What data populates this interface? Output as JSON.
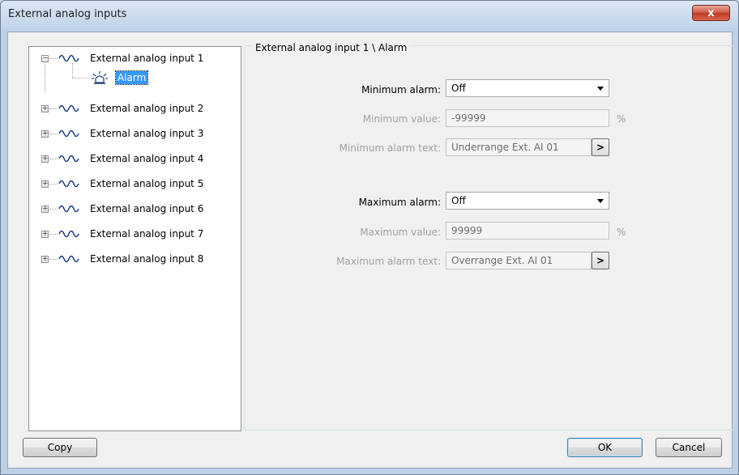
{
  "window": {
    "title": "External analog inputs",
    "close_label": "x"
  },
  "tree": {
    "inputs": [
      "External analog input 1",
      "External analog input 2",
      "External analog input 3",
      "External analog input 4",
      "External analog input 5",
      "External analog input 6",
      "External analog input 7",
      "External analog input 8"
    ],
    "selected_child": "Alarm"
  },
  "panel": {
    "title": "External analog input 1 \\ Alarm",
    "min_alarm_label": "Minimum alarm:",
    "min_alarm_value": "Off",
    "min_value_label": "Minimum value:",
    "min_value": "-99999",
    "min_unit": "%",
    "min_text_label": "Minimum alarm text:",
    "min_text": "Underrange Ext. AI 01",
    "max_alarm_label": "Maximum alarm:",
    "max_alarm_value": "Off",
    "max_value_label": "Maximum value:",
    "max_value": "99999",
    "max_unit": "%",
    "max_text_label": "Maximum alarm text:",
    "max_text": "Overrange Ext. AI 01",
    "browse_label": ">"
  },
  "buttons": {
    "copy": "Copy",
    "ok": "OK",
    "cancel": "Cancel"
  }
}
